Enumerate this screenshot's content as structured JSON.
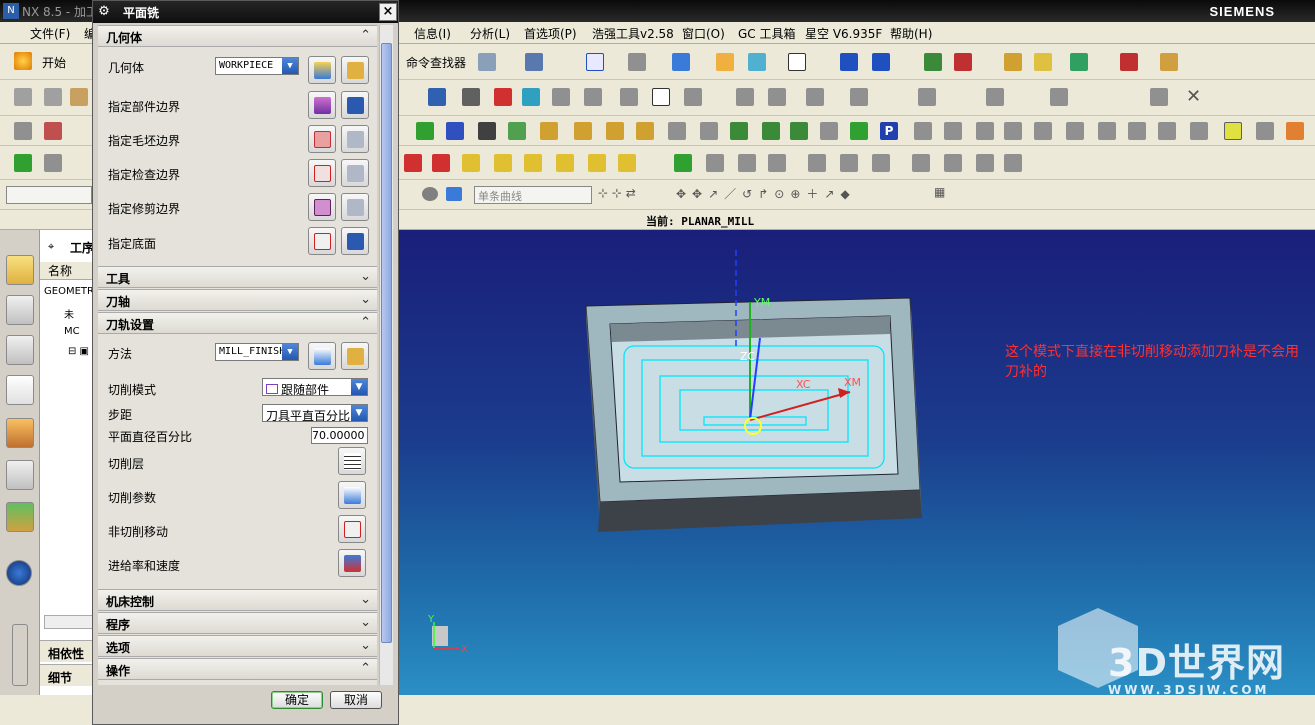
{
  "app": {
    "title": "NX 8.5 - 加工",
    "brand": "SIEMENS"
  },
  "menu": [
    "文件(F)",
    "编",
    "信息(I)",
    "分析(L)",
    "首选项(P)",
    "浩强工具v2.58",
    "窗口(O)",
    "GC 工具箱",
    "星空 V6.935F",
    "帮助(H)"
  ],
  "toolbar": {
    "start_label": "开始",
    "command_finder_label": "命令查找器",
    "curve_filter": "单条曲线"
  },
  "status": {
    "current_operation": "当前: PLANAR_MILL"
  },
  "navigator": {
    "title": "工序",
    "col_name": "名称",
    "rows": [
      "GEOMETRY",
      "未",
      "MC",
      ""
    ],
    "sections": [
      "相依性",
      "细节"
    ]
  },
  "dialog": {
    "title": "平面铣",
    "groups": {
      "geometry": "几何体",
      "tool": "工具",
      "axis": "刀轴",
      "path_settings": "刀轨设置",
      "machine_control": "机床控制",
      "program": "程序",
      "options": "选项",
      "actions": "操作"
    },
    "geometry_label": "几何体",
    "geometry_value": "WORKPIECE",
    "specify_part_boundary": "指定部件边界",
    "specify_blank_boundary": "指定毛坯边界",
    "specify_check_boundary": "指定检查边界",
    "specify_trim_boundary": "指定修剪边界",
    "specify_floor": "指定底面",
    "method_label": "方法",
    "method_value": "MILL_FINISH",
    "cut_pattern_label": "切削模式",
    "cut_pattern_value": "跟随部件",
    "stepover_label": "步距",
    "stepover_value": "刀具平直百分比",
    "flat_diameter_label": "平面直径百分比",
    "flat_diameter_value": "70.00000",
    "cut_levels": "切削层",
    "cut_params": "切削参数",
    "non_cutting": "非切削移动",
    "feeds_speeds": "进给率和速度",
    "ok": "确定",
    "cancel": "取消"
  },
  "viewport": {
    "note": "这个模式下直接在非切削移动添加刀补是不会用刀补的",
    "axis_xc": "XC",
    "axis_xm": "XM",
    "axis_zc": "ZC",
    "axis_ym": "YM",
    "triad_x": "X",
    "triad_y": "Y",
    "watermark_title": "3D世界网",
    "watermark_url": "WWW.3DSJW.COM"
  },
  "colors": {
    "viewport_top": "#1a1f7a",
    "viewport_bottom": "#2a8fc4",
    "toolpath": "#00e5ff",
    "note": "#ff3030"
  }
}
